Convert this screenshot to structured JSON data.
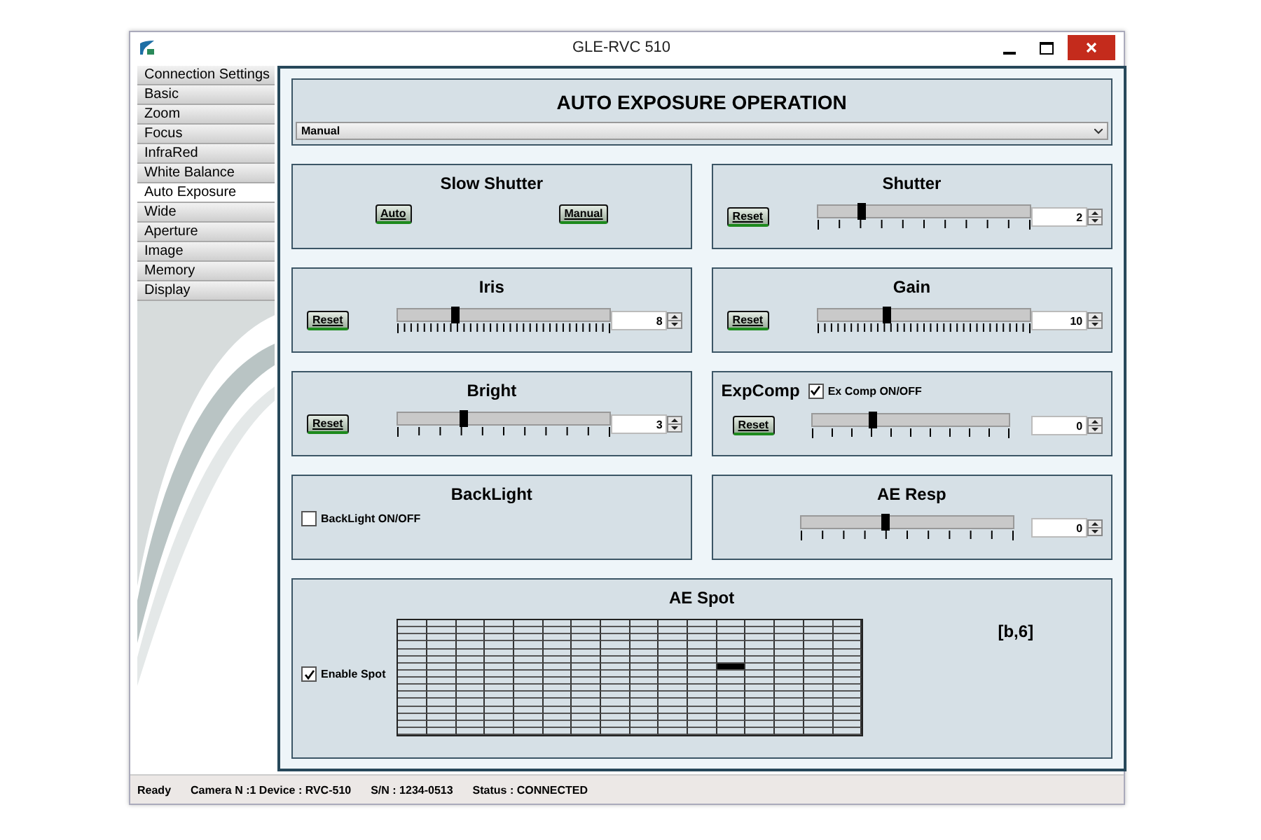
{
  "window": {
    "title": "GLE-RVC 510"
  },
  "sidebar": {
    "items": [
      {
        "label": "Connection Settings",
        "selected": false
      },
      {
        "label": "Basic",
        "selected": false
      },
      {
        "label": "Zoom",
        "selected": false
      },
      {
        "label": "Focus",
        "selected": false
      },
      {
        "label": "InfraRed",
        "selected": false
      },
      {
        "label": "White Balance",
        "selected": false
      },
      {
        "label": "Auto Exposure",
        "selected": true
      },
      {
        "label": "Wide",
        "selected": false
      },
      {
        "label": "Aperture",
        "selected": false
      },
      {
        "label": "Image",
        "selected": false
      },
      {
        "label": "Memory",
        "selected": false
      },
      {
        "label": "Display",
        "selected": false
      }
    ]
  },
  "header": {
    "title": "AUTO EXPOSURE OPERATION",
    "mode": {
      "value": "Manual"
    }
  },
  "panels": [
    {
      "kind": "buttons",
      "title": "Slow Shutter",
      "buttons": [
        "Auto",
        "Manual"
      ]
    },
    {
      "kind": "slider",
      "title": "Shutter",
      "reset": "Reset",
      "level": 0.21,
      "value": "2"
    },
    {
      "kind": "fine_slider",
      "title": "Iris",
      "reset": "Reset",
      "level": 0.27,
      "value": "8"
    },
    {
      "kind": "fine_slider",
      "title": "Gain",
      "reset": "Reset",
      "level": 0.33,
      "value": "10"
    },
    {
      "kind": "slider",
      "title": "Bright",
      "reset": "Reset",
      "level": 0.31,
      "value": "3"
    },
    {
      "kind": "slider",
      "title": "ExpComp",
      "checkbox": {
        "label": "Ex Comp ON/OFF",
        "checked": true
      },
      "reset": "Reset",
      "level": 0.31,
      "value": "0"
    },
    {
      "kind": "checkbox",
      "title": "BackLight",
      "checkbox": {
        "label": "BackLight ON/OFF",
        "checked": false
      }
    },
    {
      "kind": "slider",
      "title": "AE Resp",
      "level": 0.4,
      "value": "0"
    }
  ],
  "spot": {
    "title": "AE Spot",
    "checkbox": {
      "label": "Enable Spot",
      "checked": true
    },
    "position": "[b,6]",
    "grid": {
      "rows": [
        {
          "cells": [
            {
              "selected": false
            },
            {
              "selected": false
            },
            {
              "selected": false
            },
            {
              "selected": false
            },
            {
              "selected": false
            },
            {
              "selected": false
            },
            {
              "selected": false
            },
            {
              "selected": false
            },
            {
              "selected": false
            },
            {
              "selected": false
            },
            {
              "selected": false
            },
            {
              "selected": false
            },
            {
              "selected": false
            },
            {
              "selected": false
            },
            {
              "selected": false
            },
            {
              "selected": false
            }
          ]
        },
        {
          "cells": [
            {
              "selected": false
            },
            {
              "selected": false
            },
            {
              "selected": false
            },
            {
              "selected": false
            },
            {
              "selected": false
            },
            {
              "selected": false
            },
            {
              "selected": false
            },
            {
              "selected": false
            },
            {
              "selected": false
            },
            {
              "selected": false
            },
            {
              "selected": false
            },
            {
              "selected": false
            },
            {
              "selected": false
            },
            {
              "selected": false
            },
            {
              "selected": false
            },
            {
              "selected": false
            }
          ]
        },
        {
          "cells": [
            {
              "selected": false
            },
            {
              "selected": false
            },
            {
              "selected": false
            },
            {
              "selected": false
            },
            {
              "selected": false
            },
            {
              "selected": false
            },
            {
              "selected": false
            },
            {
              "selected": false
            },
            {
              "selected": false
            },
            {
              "selected": false
            },
            {
              "selected": false
            },
            {
              "selected": false
            },
            {
              "selected": false
            },
            {
              "selected": false
            },
            {
              "selected": false
            },
            {
              "selected": false
            }
          ]
        },
        {
          "cells": [
            {
              "selected": false
            },
            {
              "selected": false
            },
            {
              "selected": false
            },
            {
              "selected": false
            },
            {
              "selected": false
            },
            {
              "selected": false
            },
            {
              "selected": false
            },
            {
              "selected": false
            },
            {
              "selected": false
            },
            {
              "selected": false
            },
            {
              "selected": false
            },
            {
              "selected": false
            },
            {
              "selected": false
            },
            {
              "selected": false
            },
            {
              "selected": false
            },
            {
              "selected": false
            }
          ]
        },
        {
          "cells": [
            {
              "selected": false
            },
            {
              "selected": false
            },
            {
              "selected": false
            },
            {
              "selected": false
            },
            {
              "selected": false
            },
            {
              "selected": false
            },
            {
              "selected": false
            },
            {
              "selected": false
            },
            {
              "selected": false
            },
            {
              "selected": false
            },
            {
              "selected": false
            },
            {
              "selected": false
            },
            {
              "selected": false
            },
            {
              "selected": false
            },
            {
              "selected": false
            },
            {
              "selected": false
            }
          ]
        },
        {
          "cells": [
            {
              "selected": false
            },
            {
              "selected": false
            },
            {
              "selected": false
            },
            {
              "selected": false
            },
            {
              "selected": false
            },
            {
              "selected": false
            },
            {
              "selected": false
            },
            {
              "selected": false
            },
            {
              "selected": false
            },
            {
              "selected": false
            },
            {
              "selected": false
            },
            {
              "selected": false
            },
            {
              "selected": false
            },
            {
              "selected": false
            },
            {
              "selected": false
            },
            {
              "selected": false
            }
          ]
        },
        {
          "cells": [
            {
              "selected": false
            },
            {
              "selected": false
            },
            {
              "selected": false
            },
            {
              "selected": false
            },
            {
              "selected": false
            },
            {
              "selected": false
            },
            {
              "selected": false
            },
            {
              "selected": false
            },
            {
              "selected": false
            },
            {
              "selected": false
            },
            {
              "selected": false
            },
            {
              "selected": true
            },
            {
              "selected": false
            },
            {
              "selected": false
            },
            {
              "selected": false
            },
            {
              "selected": false
            }
          ]
        },
        {
          "cells": [
            {
              "selected": false
            },
            {
              "selected": false
            },
            {
              "selected": false
            },
            {
              "selected": false
            },
            {
              "selected": false
            },
            {
              "selected": false
            },
            {
              "selected": false
            },
            {
              "selected": false
            },
            {
              "selected": false
            },
            {
              "selected": false
            },
            {
              "selected": false
            },
            {
              "selected": false
            },
            {
              "selected": false
            },
            {
              "selected": false
            },
            {
              "selected": false
            },
            {
              "selected": false
            }
          ]
        },
        {
          "cells": [
            {
              "selected": false
            },
            {
              "selected": false
            },
            {
              "selected": false
            },
            {
              "selected": false
            },
            {
              "selected": false
            },
            {
              "selected": false
            },
            {
              "selected": false
            },
            {
              "selected": false
            },
            {
              "selected": false
            },
            {
              "selected": false
            },
            {
              "selected": false
            },
            {
              "selected": false
            },
            {
              "selected": false
            },
            {
              "selected": false
            },
            {
              "selected": false
            },
            {
              "selected": false
            }
          ]
        },
        {
          "cells": [
            {
              "selected": false
            },
            {
              "selected": false
            },
            {
              "selected": false
            },
            {
              "selected": false
            },
            {
              "selected": false
            },
            {
              "selected": false
            },
            {
              "selected": false
            },
            {
              "selected": false
            },
            {
              "selected": false
            },
            {
              "selected": false
            },
            {
              "selected": false
            },
            {
              "selected": false
            },
            {
              "selected": false
            },
            {
              "selected": false
            },
            {
              "selected": false
            },
            {
              "selected": false
            }
          ]
        },
        {
          "cells": [
            {
              "selected": false
            },
            {
              "selected": false
            },
            {
              "selected": false
            },
            {
              "selected": false
            },
            {
              "selected": false
            },
            {
              "selected": false
            },
            {
              "selected": false
            },
            {
              "selected": false
            },
            {
              "selected": false
            },
            {
              "selected": false
            },
            {
              "selected": false
            },
            {
              "selected": false
            },
            {
              "selected": false
            },
            {
              "selected": false
            },
            {
              "selected": false
            },
            {
              "selected": false
            }
          ]
        },
        {
          "cells": [
            {
              "selected": false
            },
            {
              "selected": false
            },
            {
              "selected": false
            },
            {
              "selected": false
            },
            {
              "selected": false
            },
            {
              "selected": false
            },
            {
              "selected": false
            },
            {
              "selected": false
            },
            {
              "selected": false
            },
            {
              "selected": false
            },
            {
              "selected": false
            },
            {
              "selected": false
            },
            {
              "selected": false
            },
            {
              "selected": false
            },
            {
              "selected": false
            },
            {
              "selected": false
            }
          ]
        },
        {
          "cells": [
            {
              "selected": false
            },
            {
              "selected": false
            },
            {
              "selected": false
            },
            {
              "selected": false
            },
            {
              "selected": false
            },
            {
              "selected": false
            },
            {
              "selected": false
            },
            {
              "selected": false
            },
            {
              "selected": false
            },
            {
              "selected": false
            },
            {
              "selected": false
            },
            {
              "selected": false
            },
            {
              "selected": false
            },
            {
              "selected": false
            },
            {
              "selected": false
            },
            {
              "selected": false
            }
          ]
        },
        {
          "cells": [
            {
              "selected": false
            },
            {
              "selected": false
            },
            {
              "selected": false
            },
            {
              "selected": false
            },
            {
              "selected": false
            },
            {
              "selected": false
            },
            {
              "selected": false
            },
            {
              "selected": false
            },
            {
              "selected": false
            },
            {
              "selected": false
            },
            {
              "selected": false
            },
            {
              "selected": false
            },
            {
              "selected": false
            },
            {
              "selected": false
            },
            {
              "selected": false
            },
            {
              "selected": false
            }
          ]
        },
        {
          "cells": [
            {
              "selected": false
            },
            {
              "selected": false
            },
            {
              "selected": false
            },
            {
              "selected": false
            },
            {
              "selected": false
            },
            {
              "selected": false
            },
            {
              "selected": false
            },
            {
              "selected": false
            },
            {
              "selected": false
            },
            {
              "selected": false
            },
            {
              "selected": false
            },
            {
              "selected": false
            },
            {
              "selected": false
            },
            {
              "selected": false
            },
            {
              "selected": false
            },
            {
              "selected": false
            }
          ]
        },
        {
          "cells": [
            {
              "selected": false
            },
            {
              "selected": false
            },
            {
              "selected": false
            },
            {
              "selected": false
            },
            {
              "selected": false
            },
            {
              "selected": false
            },
            {
              "selected": false
            },
            {
              "selected": false
            },
            {
              "selected": false
            },
            {
              "selected": false
            },
            {
              "selected": false
            },
            {
              "selected": false
            },
            {
              "selected": false
            },
            {
              "selected": false
            },
            {
              "selected": false
            },
            {
              "selected": false
            }
          ]
        }
      ]
    }
  },
  "status_bar": {
    "items": [
      "Ready",
      "Camera N :1 Device : RVC-510",
      "S/N : 1234-0513",
      "Status : CONNECTED"
    ]
  }
}
